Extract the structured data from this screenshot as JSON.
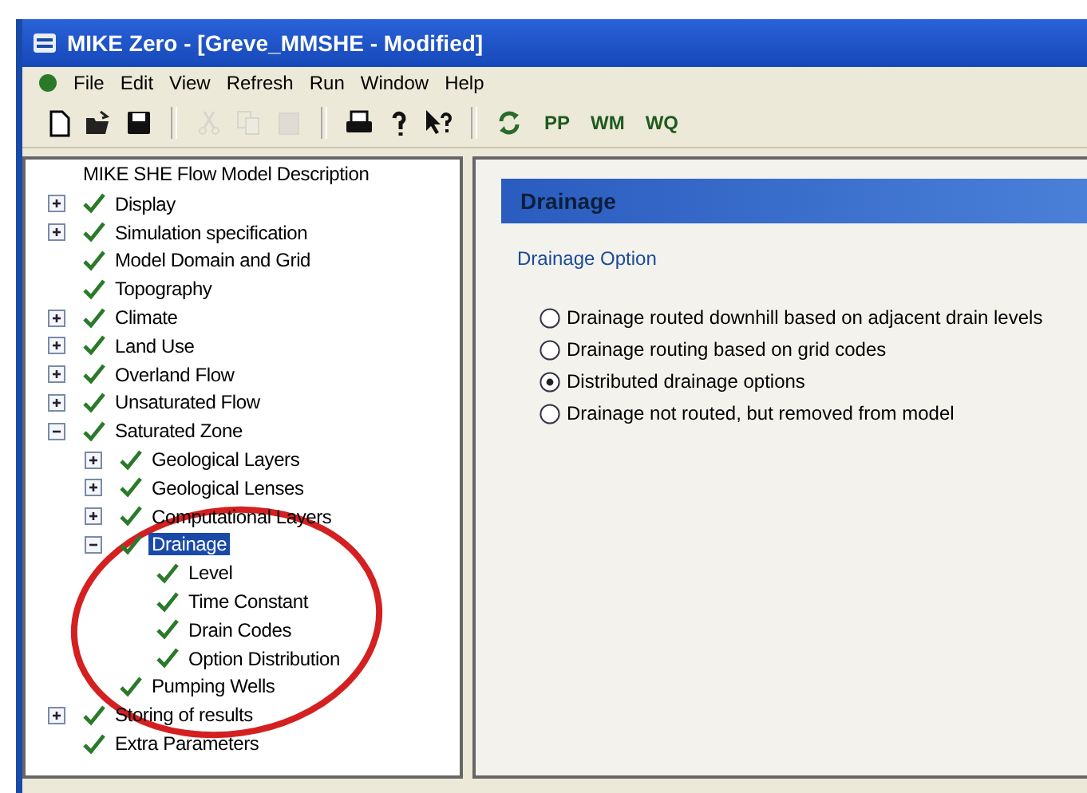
{
  "window": {
    "title": "MIKE Zero - [Greve_MMSHE - Modified]"
  },
  "menu": [
    "File",
    "Edit",
    "View",
    "Refresh",
    "Run",
    "Window",
    "Help"
  ],
  "toolbar": [
    {
      "kind": "new",
      "disabled": false
    },
    {
      "kind": "open",
      "disabled": false
    },
    {
      "kind": "save",
      "disabled": false
    },
    {
      "kind": "cut",
      "disabled": true
    },
    {
      "kind": "copy",
      "disabled": true
    },
    {
      "kind": "paste",
      "disabled": true
    },
    {
      "kind": "print",
      "disabled": false
    },
    {
      "kind": "help",
      "disabled": false
    },
    {
      "kind": "whatsthis",
      "disabled": false
    },
    {
      "kind": "refresh",
      "disabled": false
    }
  ],
  "toolbar_texts": [
    "PP",
    "WM",
    "WQ"
  ],
  "tree": {
    "title": "MIKE SHE Flow Model Description",
    "items": [
      {
        "label": "Display",
        "expanded": false,
        "checked": true,
        "selected": false
      },
      {
        "label": "Simulation specification",
        "expanded": false,
        "checked": true,
        "selected": false
      },
      {
        "label": "Model Domain and Grid",
        "checked": true,
        "selected": false
      },
      {
        "label": "Topography",
        "checked": true,
        "selected": false
      },
      {
        "label": "Climate",
        "expanded": false,
        "checked": true,
        "selected": false
      },
      {
        "label": "Land Use",
        "expanded": false,
        "checked": true,
        "selected": false
      },
      {
        "label": "Overland Flow",
        "expanded": false,
        "checked": true,
        "selected": false
      },
      {
        "label": "Unsaturated Flow",
        "expanded": false,
        "checked": true,
        "selected": false
      },
      {
        "label": "Saturated Zone",
        "expanded": true,
        "checked": true,
        "selected": false,
        "children": [
          {
            "label": "Geological Layers",
            "expanded": false,
            "checked": true,
            "selected": false
          },
          {
            "label": "Geological Lenses",
            "expanded": false,
            "checked": true,
            "selected": false
          },
          {
            "label": "Computational Layers",
            "expanded": false,
            "checked": true,
            "selected": false
          },
          {
            "label": "Drainage",
            "expanded": true,
            "checked": true,
            "selected": true,
            "children": [
              {
                "label": "Level",
                "checked": true,
                "selected": false
              },
              {
                "label": "Time Constant",
                "checked": true,
                "selected": false
              },
              {
                "label": "Drain Codes",
                "checked": true,
                "selected": false
              },
              {
                "label": "Option Distribution",
                "checked": true,
                "selected": false
              }
            ]
          },
          {
            "label": "Pumping Wells",
            "checked": true,
            "selected": false
          }
        ]
      },
      {
        "label": "Storing of results",
        "expanded": false,
        "checked": true,
        "selected": false
      },
      {
        "label": "Extra Parameters",
        "checked": true,
        "selected": false
      }
    ]
  },
  "panel": {
    "title": "Drainage",
    "group": "Drainage Option",
    "options": [
      {
        "label": "Drainage routed downhill based on adjacent drain levels",
        "selected": false
      },
      {
        "label": "Drainage routing based on grid codes",
        "selected": false
      },
      {
        "label": "Distributed drainage options",
        "selected": true
      },
      {
        "label": "Drainage not routed, but removed from model",
        "selected": false
      }
    ]
  }
}
